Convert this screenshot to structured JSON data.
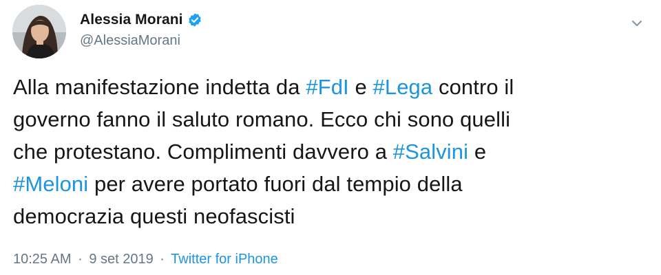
{
  "author": {
    "display_name": "Alessia Morani",
    "handle": "@AlessiaMorani",
    "verified": true,
    "avatar_icon": "profile-photo"
  },
  "menu": {
    "icon": "chevron-down-icon"
  },
  "tweet": {
    "lines": [
      [
        {
          "text": "Alla manifestazione indetta da ",
          "hashtag": false
        },
        {
          "text": "#FdI",
          "hashtag": true
        },
        {
          "text": " e ",
          "hashtag": false
        },
        {
          "text": "#Lega",
          "hashtag": true
        },
        {
          "text": " contro il",
          "hashtag": false
        }
      ],
      [
        {
          "text": "governo fanno il saluto romano. Ecco chi sono quelli",
          "hashtag": false
        }
      ],
      [
        {
          "text": "che protestano. Complimenti davvero a ",
          "hashtag": false
        },
        {
          "text": "#Salvini",
          "hashtag": true
        },
        {
          "text": " e",
          "hashtag": false
        }
      ],
      [
        {
          "text": "#Meloni",
          "hashtag": true
        },
        {
          "text": " per avere portato fuori dal tempio della",
          "hashtag": false
        }
      ],
      [
        {
          "text": "democrazia questi neofascisti",
          "hashtag": false
        }
      ]
    ]
  },
  "meta": {
    "time": "10:25 AM",
    "separator": "·",
    "date": "9 set 2019",
    "source": "Twitter for iPhone"
  },
  "colors": {
    "text": "#14171a",
    "secondary": "#657786",
    "link": "#1b95e0",
    "verified": "#1da1f2"
  }
}
